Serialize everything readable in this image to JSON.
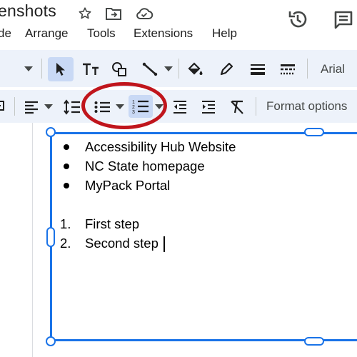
{
  "header": {
    "title": "enshots"
  },
  "menu": {
    "items": [
      "de",
      "Arrange",
      "Tools",
      "Extensions",
      "Help"
    ]
  },
  "toolbar": {
    "font_name": "Arial",
    "format_options_label": "Format options"
  },
  "textbox": {
    "bullets": [
      "Accessibility Hub Website",
      "NC State homepage",
      "MyPack Portal"
    ],
    "numbered": [
      {
        "marker": "1.",
        "text": "First step"
      },
      {
        "marker": "2.",
        "text": "Second step"
      }
    ]
  },
  "annotation": {
    "color": "#c0151c",
    "target": "numbered-list-icon"
  },
  "colors": {
    "toolbar_bg": "#edf2fa",
    "selected_bg": "#c9d9f5",
    "selection_blue": "#1a73e8"
  }
}
